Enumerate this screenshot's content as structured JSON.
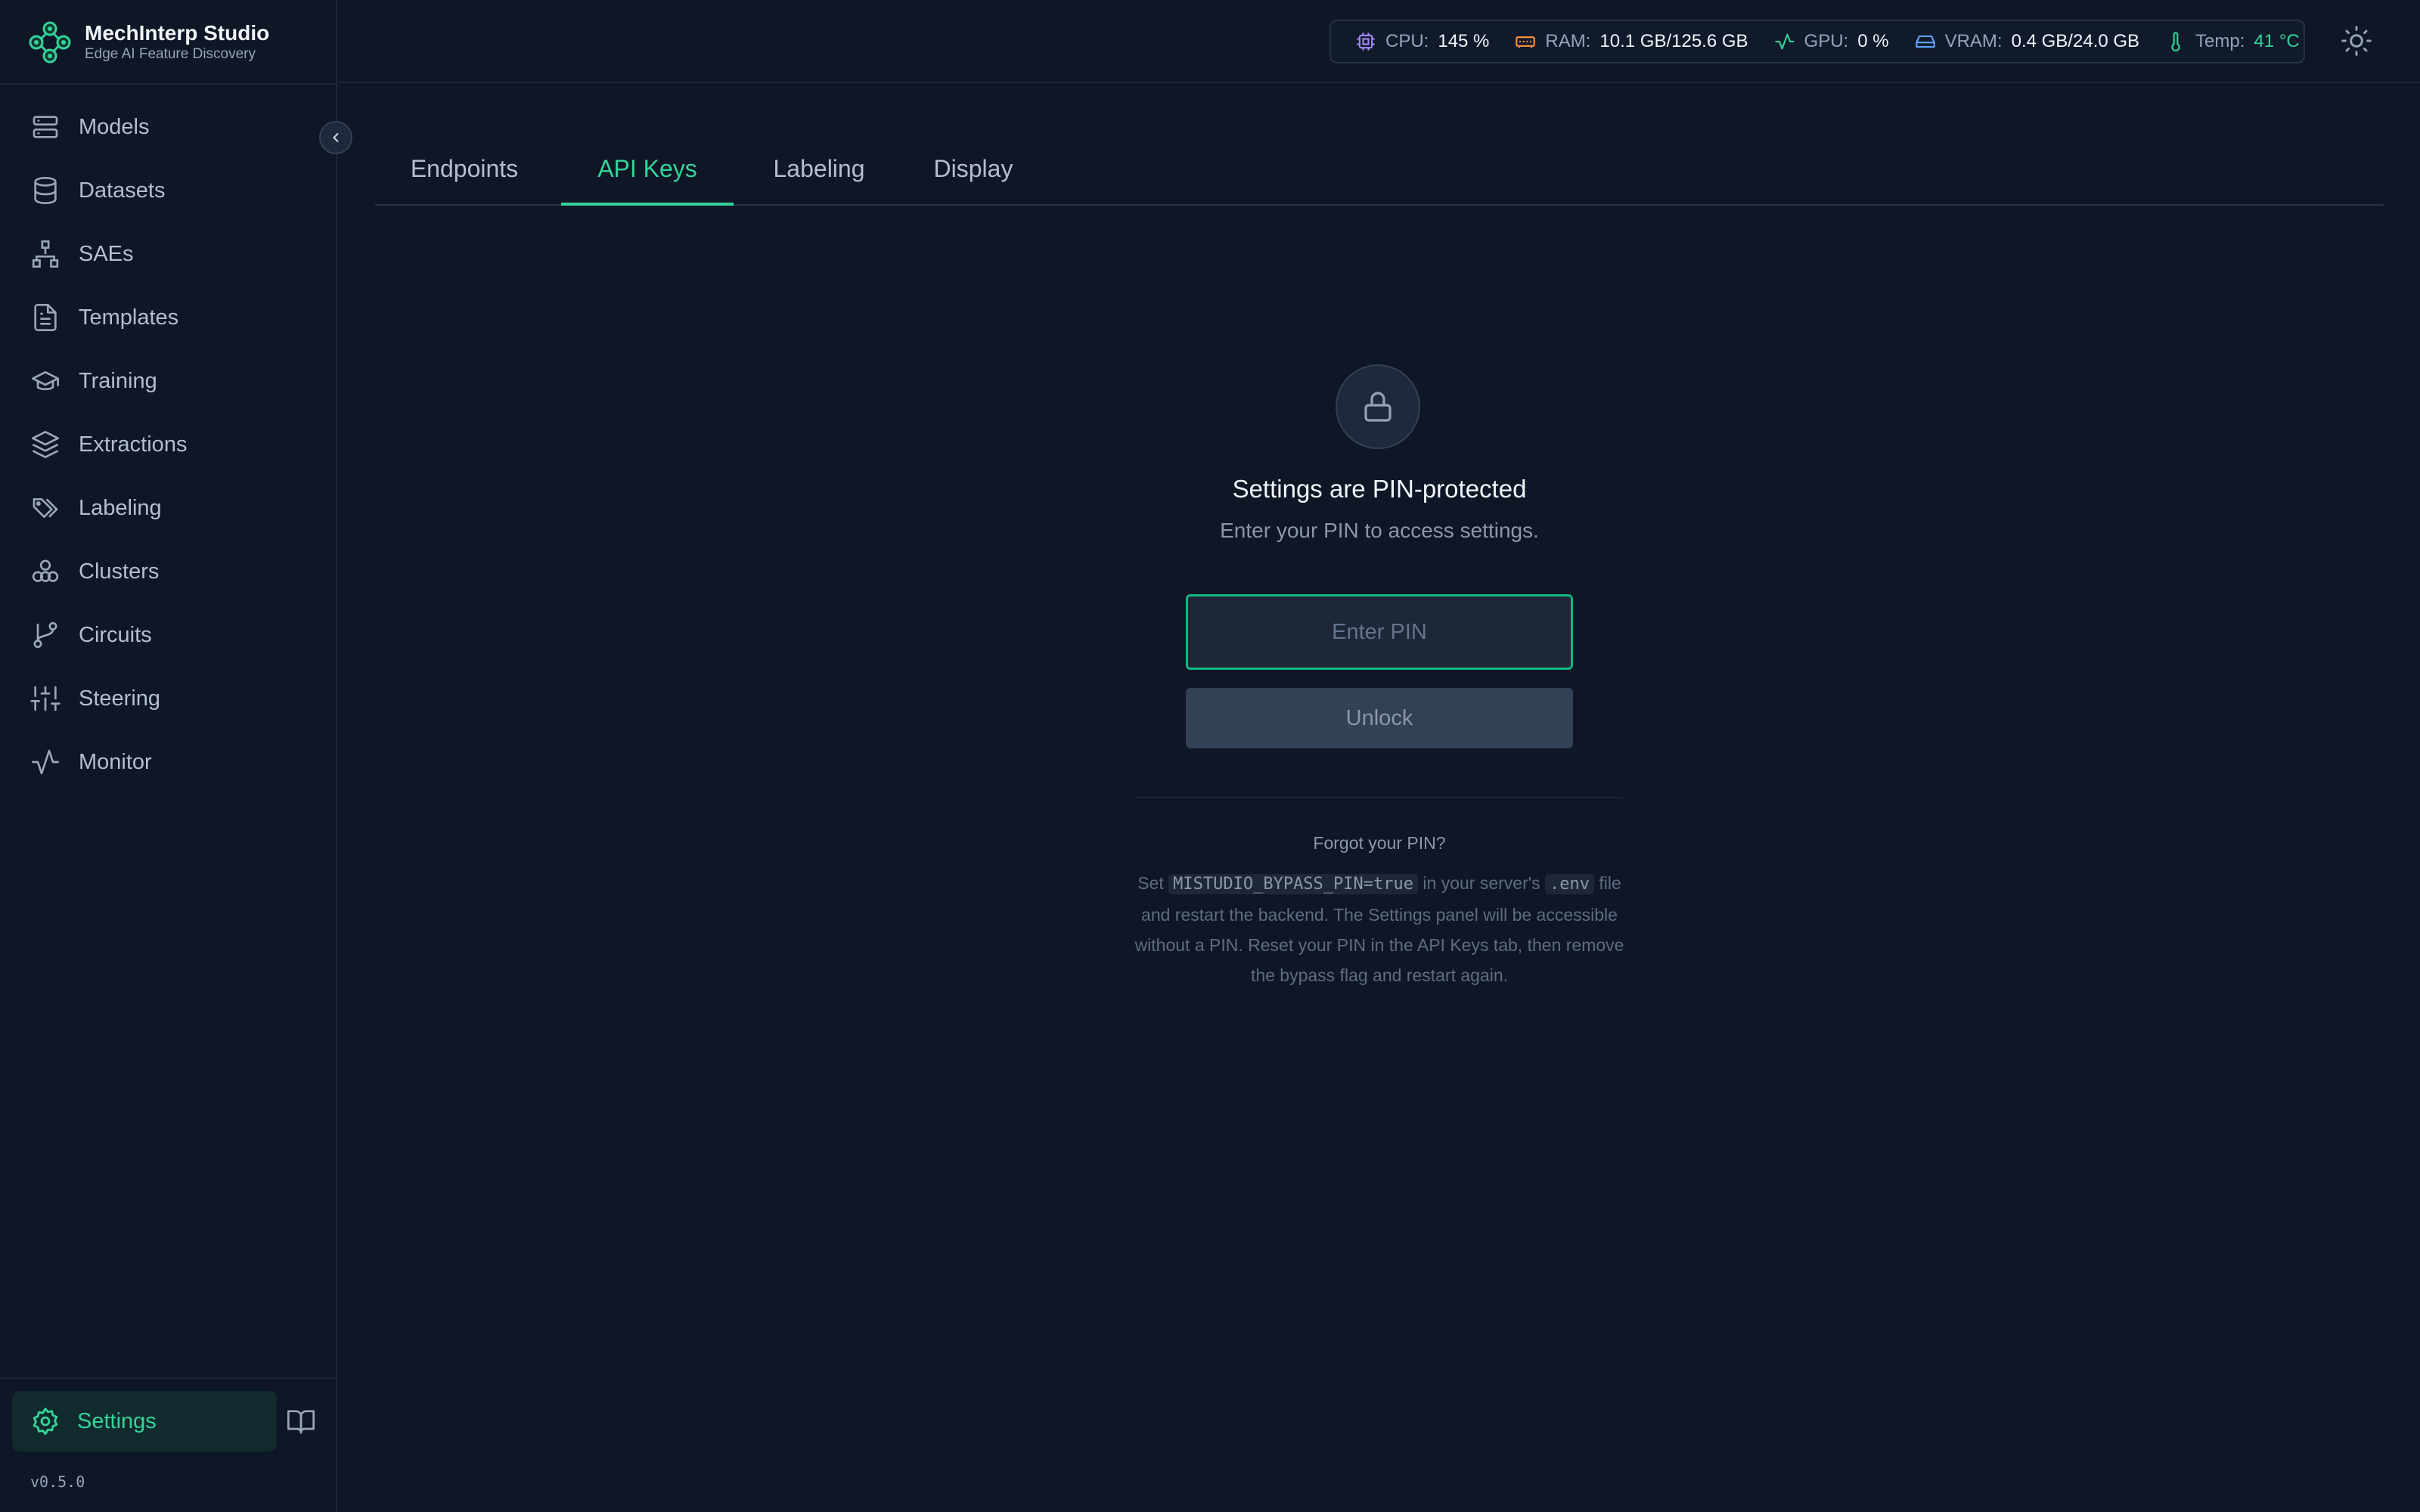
{
  "brand": {
    "title": "MechInterp Studio",
    "subtitle": "Edge AI Feature Discovery"
  },
  "nav": {
    "items": [
      {
        "label": "Models",
        "icon": "server-icon"
      },
      {
        "label": "Datasets",
        "icon": "database-icon"
      },
      {
        "label": "SAEs",
        "icon": "network-icon"
      },
      {
        "label": "Templates",
        "icon": "file-text-icon"
      },
      {
        "label": "Training",
        "icon": "graduation-cap-icon"
      },
      {
        "label": "Extractions",
        "icon": "layers-icon"
      },
      {
        "label": "Labeling",
        "icon": "tags-icon"
      },
      {
        "label": "Clusters",
        "icon": "clusters-icon"
      },
      {
        "label": "Circuits",
        "icon": "git-branch-icon"
      },
      {
        "label": "Steering",
        "icon": "sliders-icon"
      },
      {
        "label": "Monitor",
        "icon": "activity-icon"
      }
    ],
    "settings_label": "Settings",
    "version": "v0.5.0"
  },
  "stats": {
    "cpu_label": "CPU:",
    "cpu_value": "145 %",
    "ram_label": "RAM:",
    "ram_value": "10.1 GB/125.6 GB",
    "gpu_label": "GPU:",
    "gpu_value": "0 %",
    "vram_label": "VRAM:",
    "vram_value": "0.4 GB/24.0 GB",
    "temp_label": "Temp:",
    "temp_value": "41 °C"
  },
  "tabs": [
    {
      "label": "Endpoints"
    },
    {
      "label": "API Keys",
      "active": true
    },
    {
      "label": "Labeling"
    },
    {
      "label": "Display"
    }
  ],
  "lock": {
    "title": "Settings are PIN-protected",
    "subtitle": "Enter your PIN to access settings.",
    "pin_placeholder": "Enter PIN",
    "unlock_label": "Unlock"
  },
  "help": {
    "title": "Forgot your PIN?",
    "text_1": "Set ",
    "code_1": "MISTUDIO_BYPASS_PIN=true",
    "text_2": " in your server's ",
    "code_2": ".env",
    "text_3": " file and restart the backend. The Settings panel will be accessible without a PIN. Reset your PIN in the API Keys tab, then remove the bypass flag and restart again."
  },
  "colors": {
    "accent": "#34d399",
    "background": "#0f1626"
  }
}
